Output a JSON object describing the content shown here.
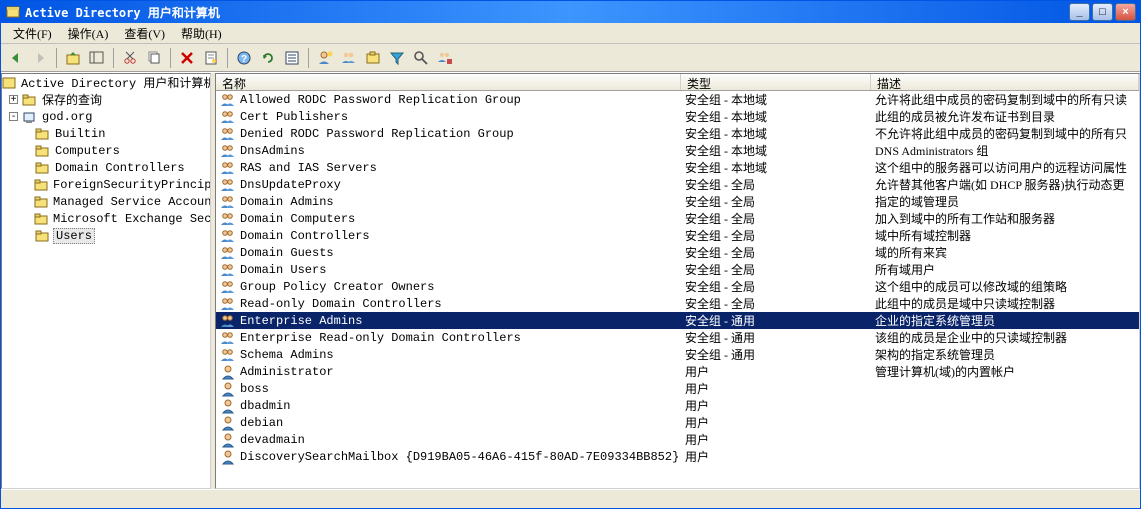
{
  "title": "Active Directory 用户和计算机",
  "menu": {
    "file": "文件(F)",
    "action": "操作(A)",
    "view": "查看(V)",
    "help": "帮助(H)"
  },
  "tree": {
    "root": "Active Directory 用户和计算机",
    "saved": "保存的查询",
    "domain": "god.org",
    "children": [
      "Builtin",
      "Computers",
      "Domain Controllers",
      "ForeignSecurityPrincip",
      "Managed Service Accoun",
      "Microsoft Exchange Sec",
      "Users"
    ]
  },
  "columns": {
    "name": "名称",
    "type": "类型",
    "desc": "描述"
  },
  "rows": [
    {
      "icon": "group",
      "name": "Allowed RODC Password Replication Group",
      "type": "安全组 - 本地域",
      "desc": "允许将此组中成员的密码复制到域中的所有只读"
    },
    {
      "icon": "group",
      "name": "Cert Publishers",
      "type": "安全组 - 本地域",
      "desc": "此组的成员被允许发布证书到目录"
    },
    {
      "icon": "group",
      "name": "Denied RODC Password Replication Group",
      "type": "安全组 - 本地域",
      "desc": "不允许将此组中成员的密码复制到域中的所有只"
    },
    {
      "icon": "group",
      "name": "DnsAdmins",
      "type": "安全组 - 本地域",
      "desc": "DNS Administrators 组"
    },
    {
      "icon": "group",
      "name": "RAS and IAS Servers",
      "type": "安全组 - 本地域",
      "desc": "这个组中的服务器可以访问用户的远程访问属性"
    },
    {
      "icon": "group",
      "name": "DnsUpdateProxy",
      "type": "安全组 - 全局",
      "desc": "允许替其他客户端(如 DHCP 服务器)执行动态更"
    },
    {
      "icon": "group",
      "name": "Domain Admins",
      "type": "安全组 - 全局",
      "desc": "指定的域管理员"
    },
    {
      "icon": "group",
      "name": "Domain Computers",
      "type": "安全组 - 全局",
      "desc": "加入到域中的所有工作站和服务器"
    },
    {
      "icon": "group",
      "name": "Domain Controllers",
      "type": "安全组 - 全局",
      "desc": "域中所有域控制器"
    },
    {
      "icon": "group",
      "name": "Domain Guests",
      "type": "安全组 - 全局",
      "desc": "域的所有来宾"
    },
    {
      "icon": "group",
      "name": "Domain Users",
      "type": "安全组 - 全局",
      "desc": "所有域用户"
    },
    {
      "icon": "group",
      "name": "Group Policy Creator Owners",
      "type": "安全组 - 全局",
      "desc": "这个组中的成员可以修改域的组策略"
    },
    {
      "icon": "group",
      "name": "Read-only Domain Controllers",
      "type": "安全组 - 全局",
      "desc": "此组中的成员是域中只读域控制器"
    },
    {
      "icon": "group",
      "name": "Enterprise Admins",
      "type": "安全组 - 通用",
      "desc": "企业的指定系统管理员",
      "selected": true
    },
    {
      "icon": "group",
      "name": "Enterprise Read-only Domain Controllers",
      "type": "安全组 - 通用",
      "desc": "该组的成员是企业中的只读域控制器"
    },
    {
      "icon": "group",
      "name": "Schema Admins",
      "type": "安全组 - 通用",
      "desc": "架构的指定系统管理员"
    },
    {
      "icon": "user",
      "name": "Administrator",
      "type": "用户",
      "desc": "管理计算机(域)的内置帐户"
    },
    {
      "icon": "user",
      "name": "boss",
      "type": "用户",
      "desc": ""
    },
    {
      "icon": "user",
      "name": "dbadmin",
      "type": "用户",
      "desc": ""
    },
    {
      "icon": "user",
      "name": "debian",
      "type": "用户",
      "desc": ""
    },
    {
      "icon": "user",
      "name": "devadmain",
      "type": "用户",
      "desc": ""
    },
    {
      "icon": "user",
      "name": "DiscoverySearchMailbox {D919BA05-46A6-415f-80AD-7E09334BB852}",
      "type": "用户",
      "desc": ""
    }
  ]
}
